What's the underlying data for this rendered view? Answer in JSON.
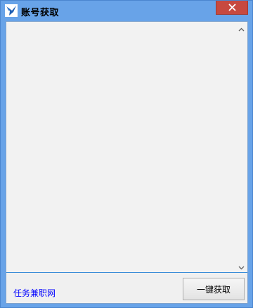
{
  "window": {
    "title": "账号获取",
    "close_symbol": "✕",
    "icon": "bird-logo-icon"
  },
  "main": {
    "output_text": "",
    "link_label": "任务兼职网",
    "fetch_button_label": "一键获取"
  },
  "colors": {
    "titlebar": "#68a3e8",
    "close_button": "#c7493f",
    "link": "#0000ff"
  }
}
